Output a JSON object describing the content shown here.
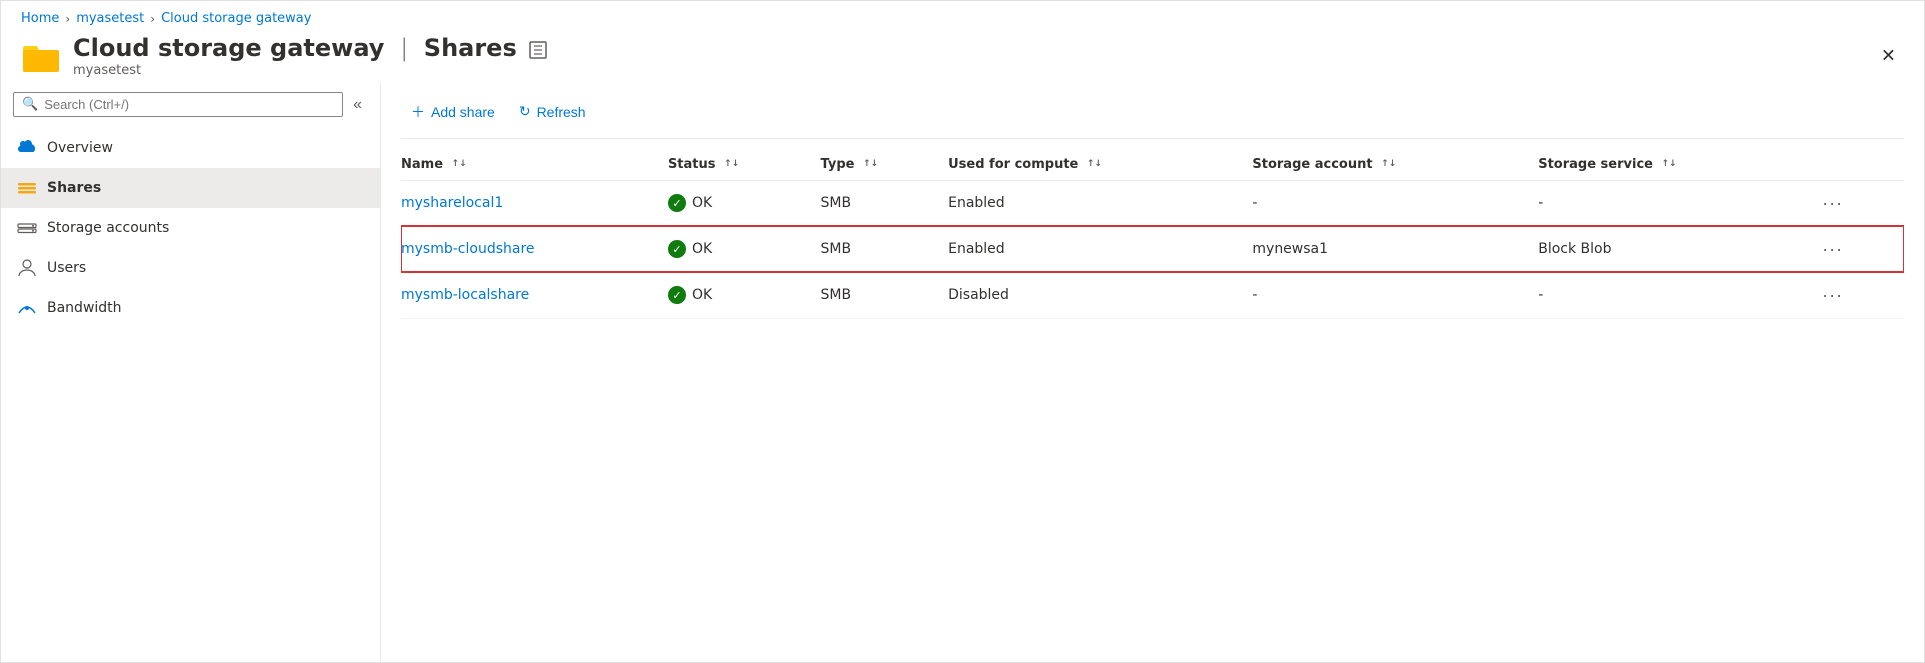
{
  "breadcrumb": {
    "home": "Home",
    "myasetest": "myasetest",
    "current": "Cloud storage gateway"
  },
  "header": {
    "title": "Cloud storage gateway",
    "pipe": "|",
    "section": "Shares",
    "subtitle": "myasetest",
    "pin_icon": "⊡"
  },
  "search": {
    "placeholder": "Search (Ctrl+/)"
  },
  "nav": {
    "items": [
      {
        "id": "overview",
        "label": "Overview",
        "icon": "cloud"
      },
      {
        "id": "shares",
        "label": "Shares",
        "icon": "shares",
        "active": true
      },
      {
        "id": "storage-accounts",
        "label": "Storage accounts",
        "icon": "storage"
      },
      {
        "id": "users",
        "label": "Users",
        "icon": "user"
      },
      {
        "id": "bandwidth",
        "label": "Bandwidth",
        "icon": "bandwidth"
      }
    ]
  },
  "toolbar": {
    "add_share": "Add share",
    "refresh": "Refresh"
  },
  "table": {
    "columns": [
      {
        "id": "name",
        "label": "Name"
      },
      {
        "id": "status",
        "label": "Status"
      },
      {
        "id": "type",
        "label": "Type"
      },
      {
        "id": "compute",
        "label": "Used for compute"
      },
      {
        "id": "storage_account",
        "label": "Storage account"
      },
      {
        "id": "storage_service",
        "label": "Storage service"
      }
    ],
    "rows": [
      {
        "name": "mysharelocal1",
        "status": "OK",
        "type": "SMB",
        "compute": "Enabled",
        "storage_account": "-",
        "storage_service": "-",
        "highlighted": false
      },
      {
        "name": "mysmb-cloudshare",
        "status": "OK",
        "type": "SMB",
        "compute": "Enabled",
        "storage_account": "mynewsa1",
        "storage_service": "Block Blob",
        "highlighted": true
      },
      {
        "name": "mysmb-localshare",
        "status": "OK",
        "type": "SMB",
        "compute": "Disabled",
        "storage_account": "-",
        "storage_service": "-",
        "highlighted": false
      }
    ]
  },
  "colors": {
    "accent": "#0078d4",
    "highlight_border": "#d13438",
    "ok_green": "#107c10"
  }
}
